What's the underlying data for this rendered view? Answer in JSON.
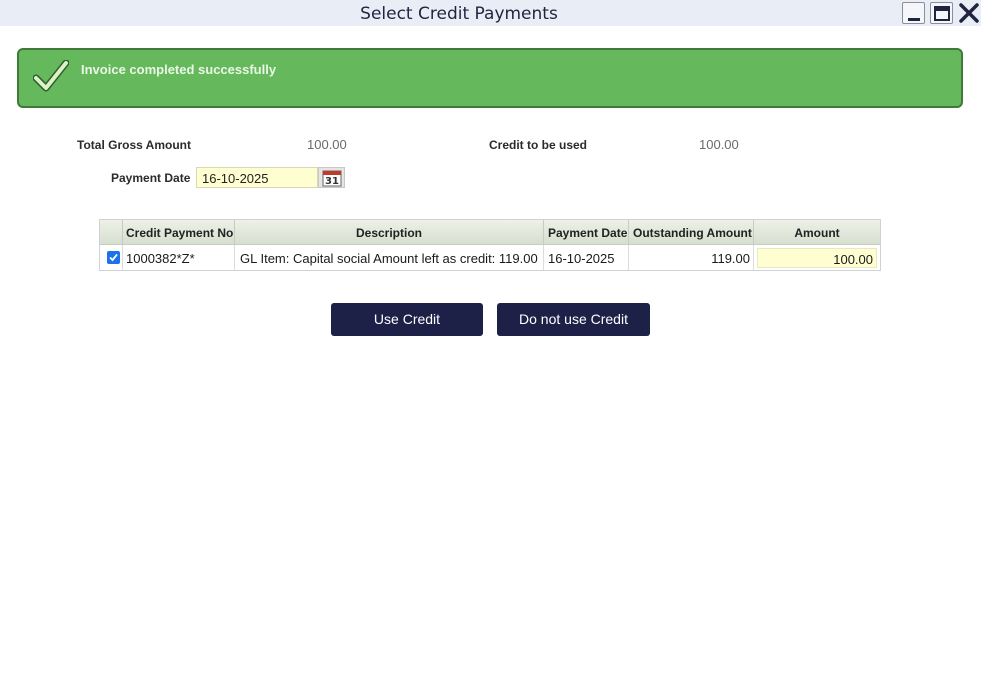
{
  "window": {
    "title": "Select Credit Payments"
  },
  "banner": {
    "message": "Invoice completed successfully"
  },
  "summary": {
    "total_gross_label": "Total Gross Amount",
    "total_gross_value": "100.00",
    "credit_used_label": "Credit to be used",
    "credit_used_value": "100.00",
    "payment_date_label": "Payment Date",
    "payment_date_value": "16-10-2025"
  },
  "table": {
    "columns": [
      "Credit Payment No",
      "Description",
      "Payment Date",
      "Outstanding Amount",
      "Amount"
    ],
    "rows": [
      {
        "checked": true,
        "credit_payment_no": "1000382*Z*",
        "description": "GL Item: Capital social Amount left as credit: 119.00",
        "payment_date": "16-10-2025",
        "outstanding_amount": "119.00",
        "amount": "100.00"
      }
    ]
  },
  "buttons": {
    "use_credit": "Use Credit",
    "do_not_use_credit": "Do not use Credit"
  },
  "colors": {
    "banner_bg": "#66b85c",
    "button_bg": "#1d2148",
    "input_bg": "#fefed1",
    "checkbox": "#1a73e8"
  }
}
